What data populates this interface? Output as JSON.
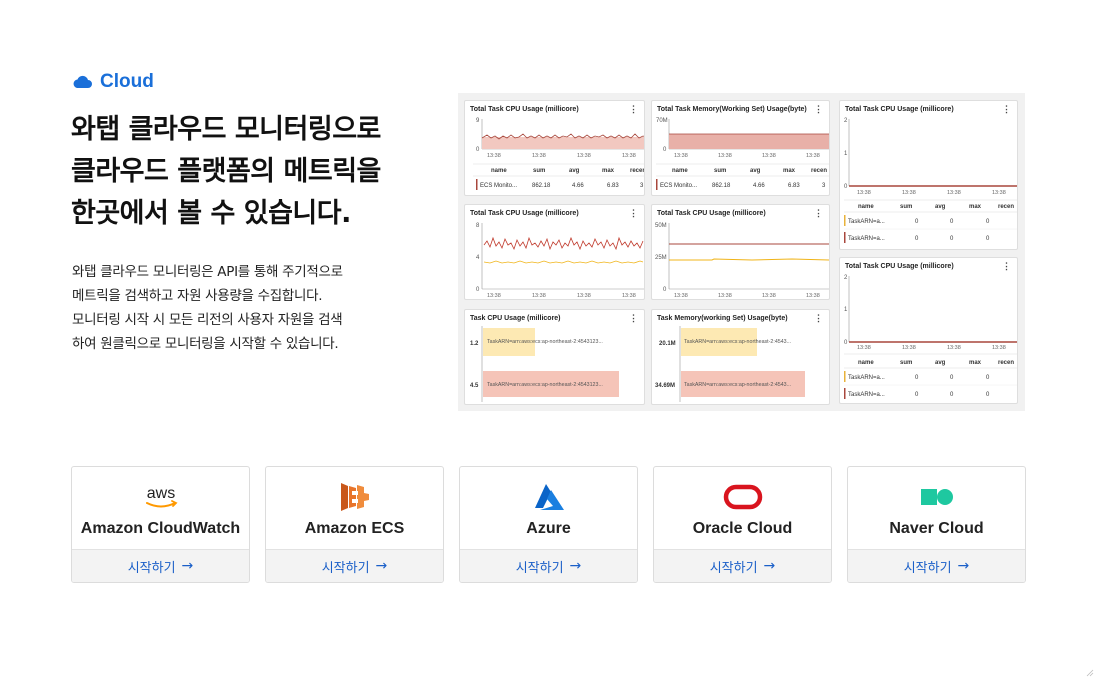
{
  "section": {
    "label": "Cloud",
    "icon": "cloud-icon",
    "accent": "#1a6fd9"
  },
  "headline": [
    "와탭 클라우드 모니터링으로",
    "클라우드 플랫폼의 메트릭을",
    "한곳에서 볼 수 있습니다."
  ],
  "description": [
    "와탭 클라우드 모니터링은 API를 통해 주기적으로",
    "메트릭을 검색하고 자원 사용량을 수집합니다.",
    "모니터링 시작 시 모든 리전의 사용자 자원을 검색",
    "하여 원클릭으로 모니터링을 시작할 수 있습니다."
  ],
  "dashboard": {
    "panels": [
      {
        "title": "Total Task CPU Usage (millicore)",
        "y_top": "9",
        "y_bottom": "0",
        "x_ticks": [
          "13:38",
          "13:38",
          "13:38",
          "13:38"
        ],
        "table_headers": [
          "name",
          "sum",
          "avg",
          "max",
          "recen"
        ],
        "rows": [
          [
            "ECS Monito...",
            "862.18",
            "4.66",
            "6.83",
            "3"
          ]
        ]
      },
      {
        "title": "Total Task Memory(Working Set) Usage(byte)",
        "y_top": "70M",
        "y_bottom": "0",
        "x_ticks": [
          "13:38",
          "13:38",
          "13:38",
          "13:38"
        ],
        "table_headers": [
          "name",
          "sum",
          "avg",
          "max",
          "recen"
        ],
        "rows": [
          [
            "ECS Monito...",
            "862.18",
            "4.66",
            "6.83",
            "3"
          ]
        ]
      },
      {
        "title": "Total Task CPU Usage (millicore)",
        "y_top": "2",
        "y_mid": "1",
        "y_bottom": "0",
        "x_ticks": [
          "13:38",
          "13:38",
          "13:38",
          "13:38"
        ],
        "table_headers": [
          "name",
          "sum",
          "avg",
          "max",
          "recen"
        ],
        "rows": [
          [
            "TaskARN=a...",
            "0",
            "0",
            "0",
            ""
          ],
          [
            "TaskARN=a...",
            "0",
            "0",
            "0",
            ""
          ]
        ]
      },
      {
        "title": "Total Task CPU Usage (millicore)",
        "y_top": "8",
        "y_mid": "4",
        "y_bottom": "0",
        "x_ticks": [
          "13:38",
          "13:38",
          "13:38",
          "13:38"
        ]
      },
      {
        "title": "Total Task CPU Usage (millicore)",
        "y_top": "50M",
        "y_mid": "25M",
        "y_bottom": "0",
        "x_ticks": [
          "13:38",
          "13:38",
          "13:38",
          "13:38"
        ]
      },
      {
        "title": "Total Task CPU Usage (millicore)",
        "y_top": "2",
        "y_mid": "1",
        "y_bottom": "0",
        "x_ticks": [
          "13:38",
          "13:38",
          "13:38",
          "13:38"
        ],
        "table_headers": [
          "name",
          "sum",
          "avg",
          "max",
          "recen"
        ],
        "rows": [
          [
            "TaskARN=a...",
            "0",
            "0",
            "0",
            ""
          ],
          [
            "TaskARN=a...",
            "0",
            "0",
            "0",
            ""
          ]
        ]
      },
      {
        "title": "Task CPU Usage (millicore)",
        "bars": [
          {
            "value": "1.2",
            "label": "TaskARN=arn:aws:ecs:ap-northeast-2:4543123...",
            "color": "#fde9b3"
          },
          {
            "value": "4.5",
            "label": "TaskARN=arn:aws:ecs:ap-northeast-2:4543123...",
            "color": "#f5c4b8"
          }
        ]
      },
      {
        "title": "Task Memory(working Set) Usage(byte)",
        "bars": [
          {
            "value": "20.1M",
            "label": "TaskARN=arn:aws:ecs:ap-northeast-2:4543...",
            "color": "#fde9b3"
          },
          {
            "value": "34.69M",
            "label": "TaskARN=arn:aws:ecs:ap-northeast-2:4543...",
            "color": "#f5c4b8"
          }
        ]
      }
    ],
    "menu_glyph": "⋮"
  },
  "cards": [
    {
      "name": "Amazon CloudWatch",
      "logo": "aws-logo",
      "logo_text": "aws",
      "cta": "시작하기"
    },
    {
      "name": "Amazon ECS",
      "logo": "ecs-logo",
      "cta": "시작하기"
    },
    {
      "name": "Azure",
      "logo": "azure-logo",
      "cta": "시작하기"
    },
    {
      "name": "Oracle Cloud",
      "logo": "oracle-logo",
      "cta": "시작하기"
    },
    {
      "name": "Naver Cloud",
      "logo": "naver-cloud-logo",
      "cta": "시작하기"
    }
  ],
  "cta_arrow": "→",
  "colors": {
    "aws": "#222",
    "aws_smile": "#f90",
    "ecs": "#e8742a",
    "azure": "#0a64c8",
    "oracle": "#d9141e",
    "naver": "#1ec8a0",
    "cta": "#1a5fc8"
  }
}
